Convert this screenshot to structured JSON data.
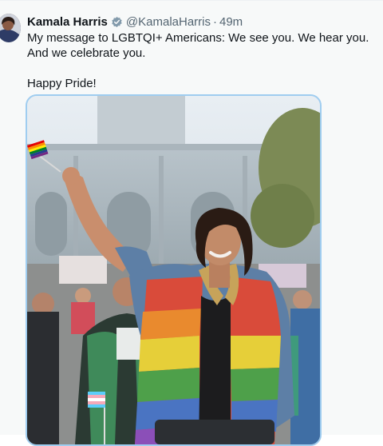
{
  "tweet": {
    "author_name": "Kamala Harris",
    "author_handle": "@KamalaHarris",
    "separator": "·",
    "timestamp": "49m",
    "verified": true,
    "text_line1": "My message to LGBTQI+ Americans: We see you. We hear you. And we celebrate you.",
    "text_line2": "Happy Pride!",
    "avatar_icon": "profile-photo",
    "verified_icon": "verified-badge-icon",
    "media": {
      "kind": "photo",
      "description_icon": "pride-parade-photo"
    }
  },
  "colors": {
    "background": "#f7f9f9",
    "name": "#0f1419",
    "secondary_text": "#536471",
    "verified_badge": "#829aab",
    "media_border": "#9fcdf0"
  }
}
